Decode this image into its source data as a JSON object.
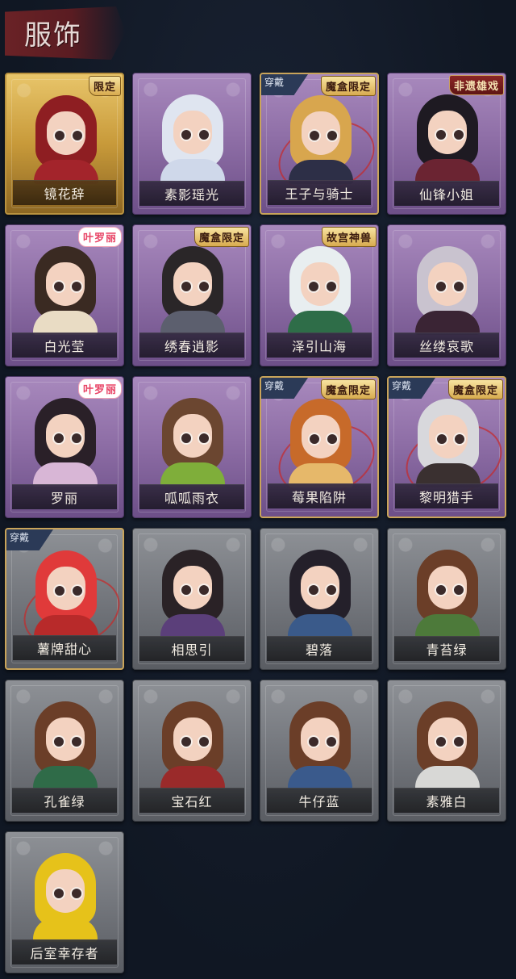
{
  "section": {
    "title": "服饰"
  },
  "labels": {
    "equipped": "穿戴"
  },
  "items": [
    {
      "name": "镜花辞",
      "badge": "限定",
      "badge_style": "gold",
      "equipped": false,
      "card_style": "gold",
      "hair": "#8e1e22",
      "body": "#a3242b"
    },
    {
      "name": "素影瑶光",
      "badge": "",
      "badge_style": "",
      "equipped": false,
      "card_style": "purple",
      "hair": "#dfe5f0",
      "body": "#cfd8ea"
    },
    {
      "name": "王子与骑士",
      "badge": "魔盒限定",
      "badge_style": "gold",
      "equipped": true,
      "card_style": "purple",
      "hair": "#d8a64e",
      "body": "#2d2f47"
    },
    {
      "name": "仙锋小姐",
      "badge": "非遗雄戏",
      "badge_style": "red",
      "equipped": false,
      "card_style": "purple",
      "hair": "#1e1a22",
      "body": "#6b2432"
    },
    {
      "name": "白光莹",
      "badge": "叶罗丽",
      "badge_style": "pink",
      "equipped": false,
      "card_style": "purple",
      "hair": "#3a2a22",
      "body": "#e9dcc4"
    },
    {
      "name": "绣春逍影",
      "badge": "魔盒限定",
      "badge_style": "gold",
      "equipped": false,
      "card_style": "purple",
      "hair": "#2a2628",
      "body": "#5c5f6e"
    },
    {
      "name": "泽引山海",
      "badge": "故宫神兽",
      "badge_style": "gold",
      "equipped": false,
      "card_style": "purple",
      "hair": "#e8eef0",
      "body": "#2e6d48"
    },
    {
      "name": "丝缕哀歌",
      "badge": "",
      "badge_style": "",
      "equipped": false,
      "card_style": "purple",
      "hair": "#c9c3cf",
      "body": "#3a2434"
    },
    {
      "name": "罗丽",
      "badge": "叶罗丽",
      "badge_style": "pink",
      "equipped": false,
      "card_style": "purple",
      "hair": "#2a2028",
      "body": "#d8b6d6"
    },
    {
      "name": "呱呱雨衣",
      "badge": "",
      "badge_style": "",
      "equipped": false,
      "card_style": "purple",
      "hair": "#6b4630",
      "body": "#7fae3a"
    },
    {
      "name": "莓果陷阱",
      "badge": "魔盒限定",
      "badge_style": "gold",
      "equipped": true,
      "card_style": "purple",
      "hair": "#c76a2a",
      "body": "#e6b86a"
    },
    {
      "name": "黎明猎手",
      "badge": "魔盒限定",
      "badge_style": "gold",
      "equipped": true,
      "card_style": "purple",
      "hair": "#d8d8dc",
      "body": "#3a3030"
    },
    {
      "name": "薯牌甜心",
      "badge": "",
      "badge_style": "",
      "equipped": true,
      "card_style": "grey",
      "hair": "#e03a3a",
      "body": "#b82a2a"
    },
    {
      "name": "相思引",
      "badge": "",
      "badge_style": "",
      "equipped": false,
      "card_style": "grey",
      "hair": "#2a2226",
      "body": "#5b3f7a"
    },
    {
      "name": "碧落",
      "badge": "",
      "badge_style": "",
      "equipped": false,
      "card_style": "grey",
      "hair": "#24202a",
      "body": "#3a5a8a"
    },
    {
      "name": "青苔绿",
      "badge": "",
      "badge_style": "",
      "equipped": false,
      "card_style": "grey",
      "hair": "#6b3e28",
      "body": "#4d7a3a"
    },
    {
      "name": "孔雀绿",
      "badge": "",
      "badge_style": "",
      "equipped": false,
      "card_style": "grey",
      "hair": "#6b3e28",
      "body": "#2f6b48"
    },
    {
      "name": "宝石红",
      "badge": "",
      "badge_style": "",
      "equipped": false,
      "card_style": "grey",
      "hair": "#6b3e28",
      "body": "#9a2a2a"
    },
    {
      "name": "牛仔蓝",
      "badge": "",
      "badge_style": "",
      "equipped": false,
      "card_style": "grey",
      "hair": "#6b3e28",
      "body": "#3a5a8c"
    },
    {
      "name": "素雅白",
      "badge": "",
      "badge_style": "",
      "equipped": false,
      "card_style": "grey",
      "hair": "#6b3e28",
      "body": "#d8d8d6"
    },
    {
      "name": "后室幸存者",
      "badge": "",
      "badge_style": "",
      "equipped": false,
      "card_style": "grey",
      "hair": "#e6c21a",
      "body": "#e6c21a"
    }
  ]
}
